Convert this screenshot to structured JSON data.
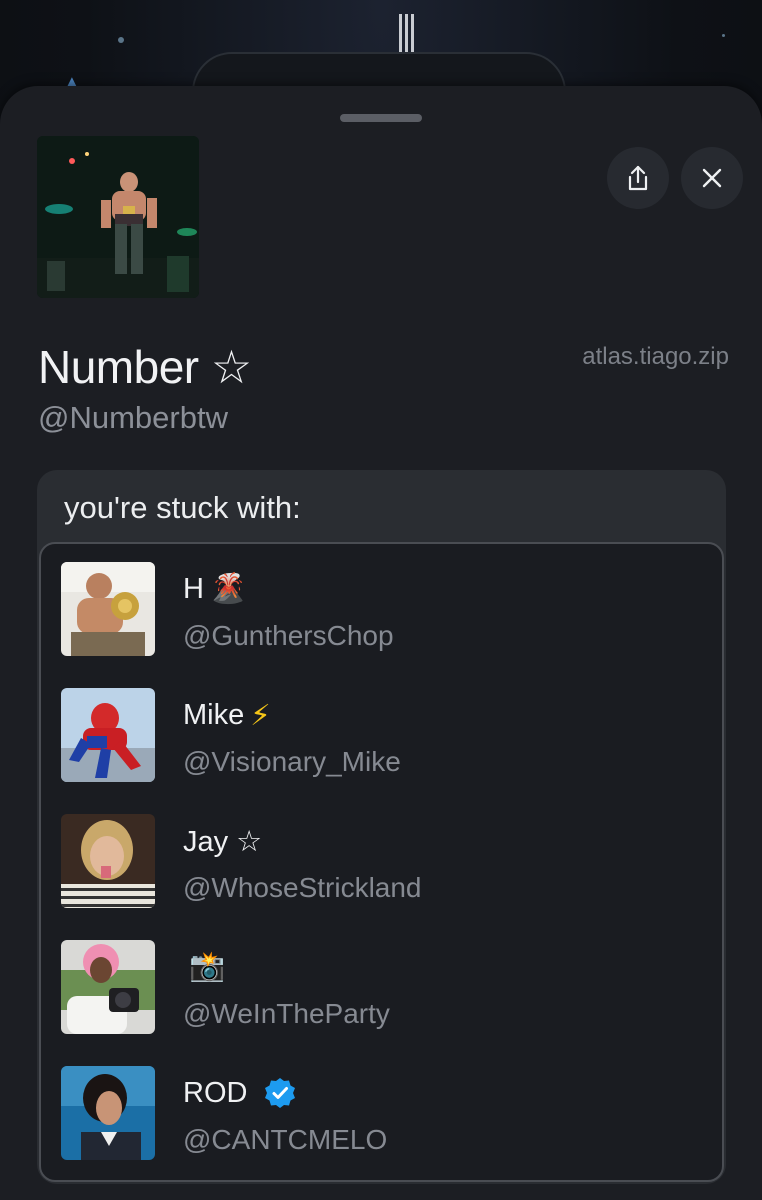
{
  "profile": {
    "display_name": "Number ☆",
    "handle": "@Numberbtw",
    "site": "atlas.tiago.zip"
  },
  "actions": {
    "share_icon": "share-icon",
    "close_icon": "close-icon"
  },
  "stuck": {
    "title": "you're stuck with:",
    "people": [
      {
        "name": "H",
        "emoji": "🌋",
        "handle": "@GunthersChop"
      },
      {
        "name": "Mike",
        "emoji": "⚡",
        "handle": "@Visionary_Mike"
      },
      {
        "name": "Jay ☆",
        "emoji": "",
        "handle": "@WhoseStrickland"
      },
      {
        "name": "",
        "emoji": "📸",
        "handle": "@WeInTheParty"
      },
      {
        "name": "ROD",
        "emoji": "",
        "handle": "@CANTCMELO",
        "verified": true
      }
    ]
  },
  "colors": {
    "sheet_bg": "#1c1e23",
    "card_bg": "#2a2d32",
    "verified_badge": "#1d9bf0"
  }
}
